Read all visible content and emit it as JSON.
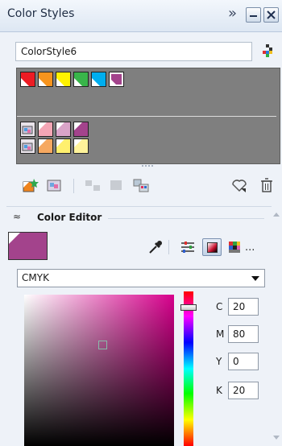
{
  "window": {
    "title": "Color Styles"
  },
  "style_name": "ColorStyle6",
  "swatch_rows": [
    [
      {
        "color": "#ed1c24"
      },
      {
        "color": "#f7941d"
      },
      {
        "color": "#fff200"
      },
      {
        "color": "#39b54a"
      },
      {
        "color": "#00aeef"
      },
      {
        "color": "#a3438c",
        "selected": true
      }
    ],
    [
      {
        "color": "#e9e3ea",
        "icon": true
      },
      {
        "color": "#f4a6b5"
      },
      {
        "color": "#d9a4c8"
      },
      {
        "color": "#a3438c"
      }
    ],
    [
      {
        "color": "#e9e3ea",
        "icon": true
      },
      {
        "color": "#f6a860"
      },
      {
        "color": "#fff06e"
      },
      {
        "color": "#fff39a"
      }
    ]
  ],
  "color_editor": {
    "title": "Color Editor",
    "current_color": "#a3438c",
    "model": "CMYK",
    "more": "...",
    "cmyk": [
      {
        "label": "C",
        "value": "20"
      },
      {
        "label": "M",
        "value": "80"
      },
      {
        "label": "Y",
        "value": "0"
      },
      {
        "label": "K",
        "value": "20"
      }
    ]
  }
}
